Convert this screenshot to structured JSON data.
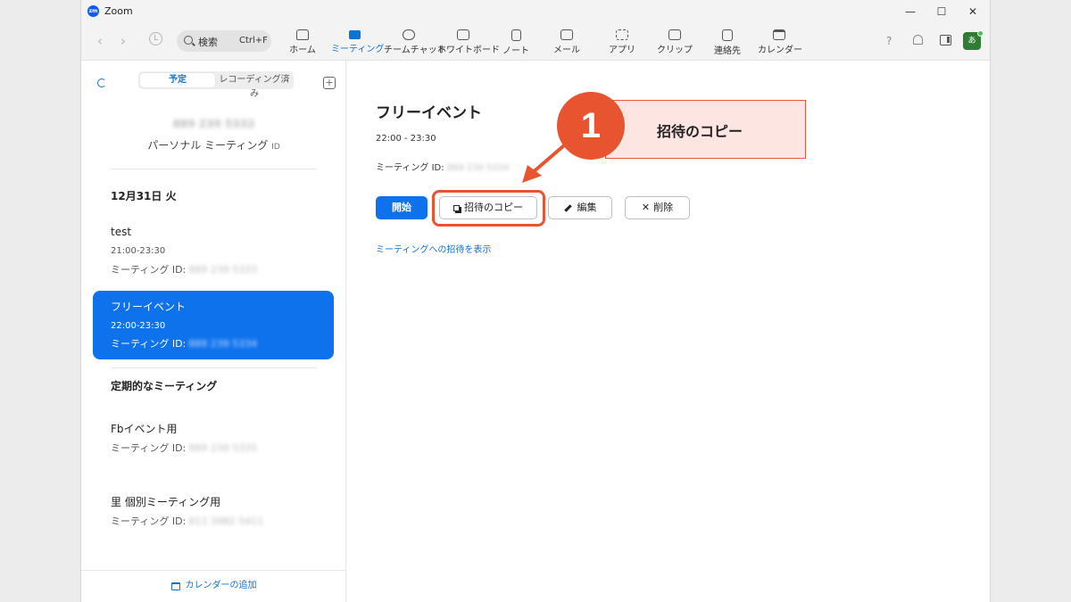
{
  "window": {
    "app_logo": "zm",
    "title": "Zoom"
  },
  "toolbar": {
    "search_label": "検索",
    "search_shortcut": "Ctrl+F",
    "nav": [
      {
        "label": "ホーム",
        "icon": "home-icon"
      },
      {
        "label": "ミーティング",
        "icon": "video-icon",
        "active": true
      },
      {
        "label": "チームチャット",
        "icon": "chat-icon"
      },
      {
        "label": "ホワイトボード",
        "icon": "whiteboard-icon"
      },
      {
        "label": "ノート",
        "icon": "note-icon"
      },
      {
        "label": "メール",
        "icon": "mail-icon"
      },
      {
        "label": "アプリ",
        "icon": "apps-icon"
      },
      {
        "label": "クリップ",
        "icon": "clip-icon"
      },
      {
        "label": "連絡先",
        "icon": "contacts-icon"
      },
      {
        "label": "カレンダー",
        "icon": "calendar-icon"
      }
    ],
    "avatar_initial": "あ"
  },
  "sidebar": {
    "tabs": {
      "scheduled": "予定",
      "recorded": "レコーディング済み"
    },
    "personal_meeting_id": "889 239 5332",
    "personal_meeting_label": "パーソナル ミーティング",
    "personal_meeting_suffix": "ID",
    "date_heading": "12月31日 火",
    "meetings": [
      {
        "title": "test",
        "time": "21:00-23:30",
        "id_label": "ミーティング ID:",
        "id_value": "889 239 5333"
      },
      {
        "title": "フリーイベント",
        "time": "22:00-23:30",
        "id_label": "ミーティング ID:",
        "id_value": "889 239 5334",
        "selected": true
      }
    ],
    "recurring_heading": "定期的なミーティング",
    "recurring": [
      {
        "title": "Fbイベント用",
        "id_label": "ミーティング ID:",
        "id_value": "889 239 5335"
      },
      {
        "title": "里 個別ミーティング用",
        "id_label": "ミーティング ID:",
        "id_value": "813 3982 5411"
      }
    ],
    "footer_label": "カレンダーの追加"
  },
  "detail": {
    "title": "フリーイベント",
    "time": "22:00 - 23:30",
    "id_label": "ミーティング ID:",
    "id_value": "889 239 5334",
    "start_label": "開始",
    "copy_label": "招待のコピー",
    "edit_label": "編集",
    "delete_label": "削除",
    "show_invite_link": "ミーティングへの招待を表示"
  },
  "annotation": {
    "step_number": "1",
    "callout_text": "招待のコピー",
    "accent_color": "#e8542f",
    "callout_bg": "#fde6e2"
  }
}
